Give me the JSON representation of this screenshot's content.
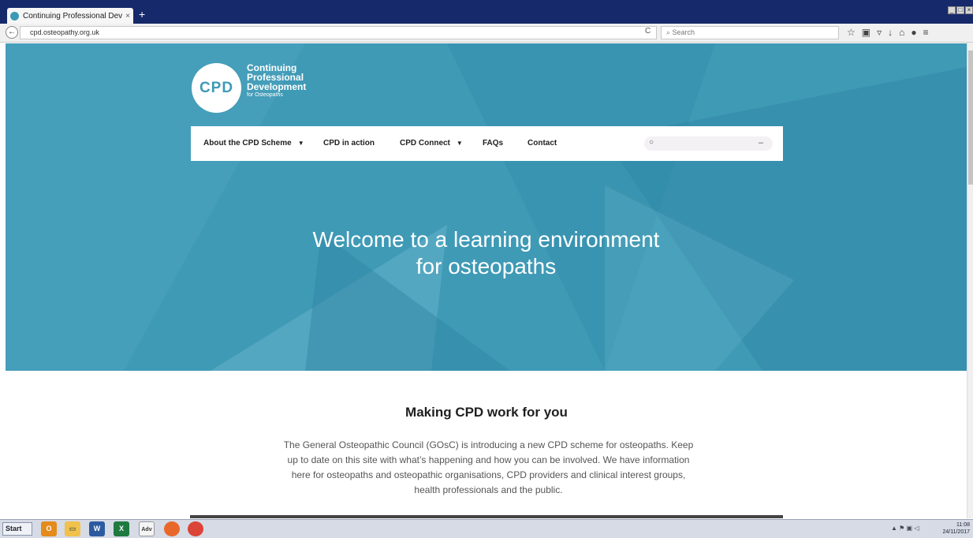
{
  "browser": {
    "tab_title": "Continuing Professional Devel...",
    "tab_close": "×",
    "new_tab": "+",
    "url": "cpd.osteopathy.org.uk",
    "search_placeholder": "Search",
    "toolbar_icons": [
      "star-icon",
      "clipboard-icon",
      "pocket-icon",
      "download-icon",
      "home-icon",
      "chat-icon",
      "menu-icon"
    ]
  },
  "site": {
    "logo": {
      "badge": "CPD",
      "line1": "Continuing",
      "line2": "Professional",
      "line3": "Development",
      "tagline": "for Osteopaths"
    },
    "menu": [
      {
        "label": "About the CPD Scheme",
        "has_dropdown": true
      },
      {
        "label": "CPD in action",
        "has_dropdown": false
      },
      {
        "label": "CPD Connect",
        "has_dropdown": true
      },
      {
        "label": "FAQs",
        "has_dropdown": false
      },
      {
        "label": "Contact",
        "has_dropdown": false
      }
    ],
    "hero_heading_line1": "Welcome to a learning environment",
    "hero_heading_line2": "for osteopaths",
    "section_title": "Making CPD work for you",
    "intro": "The General Osteopathic Council (GOsC) is introducing a new CPD scheme for osteopaths. Keep up to date on this site with what’s happening and how you can be involved. We have information here for osteopaths and osteopathic organisations, CPD providers and clinical interest groups, health professionals and the public."
  },
  "colors": {
    "brand_teal": "#3f9ab6",
    "tabbar": "#16296a"
  },
  "taskbar": {
    "start_label": "Start",
    "apps": [
      "outlook",
      "explorer",
      "word",
      "excel",
      "Adv",
      "firefox",
      "chrome"
    ],
    "time": "11:08",
    "date": "24/11/2017"
  }
}
